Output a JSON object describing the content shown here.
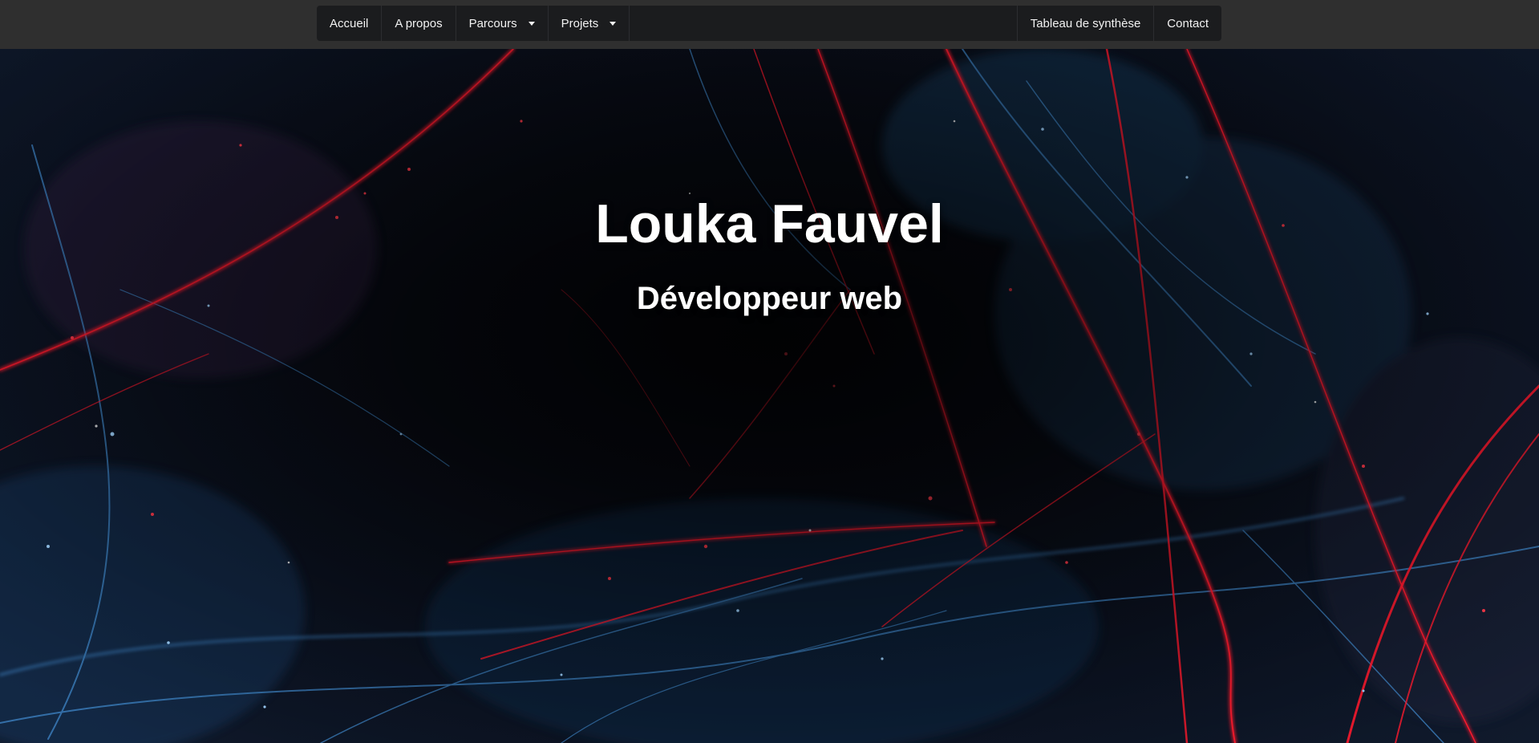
{
  "nav": {
    "left": [
      {
        "label": "Accueil"
      },
      {
        "label": "A propos"
      },
      {
        "label": "Parcours",
        "dropdown": true
      },
      {
        "label": "Projets",
        "dropdown": true
      }
    ],
    "right": [
      {
        "label": "Tableau de synthèse"
      },
      {
        "label": "Contact"
      }
    ]
  },
  "hero": {
    "title": "Louka Fauvel",
    "subtitle": "Développeur web",
    "background": "abstract-red-blue-fibers-image"
  },
  "colors": {
    "page_bg": "#2f2f2f",
    "navbar_bg": "#1b1c1e",
    "nav_text": "#f2f2f2",
    "hero_text": "#ffffff",
    "fiber_red": "#ff1a2e",
    "fiber_blue": "#4a8fd0"
  }
}
